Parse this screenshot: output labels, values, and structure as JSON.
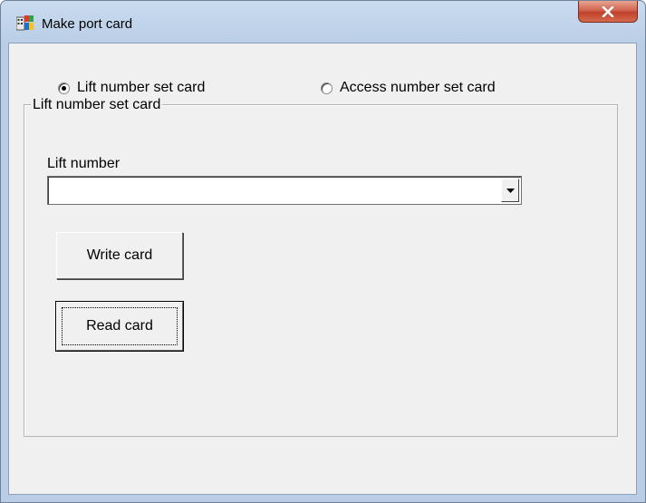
{
  "window": {
    "title": "Make port card",
    "icon": "app-icon",
    "close_icon": "close-icon"
  },
  "mode": {
    "options": [
      {
        "label": "Lift number set card",
        "selected": true
      },
      {
        "label": "Access number set card",
        "selected": false
      }
    ]
  },
  "group": {
    "title": "Lift number set card",
    "lift_number_label": "Lift number",
    "lift_number_value": "",
    "dropdown_icon": "chevron-down-icon"
  },
  "buttons": {
    "write": "Write card",
    "read": "Read card"
  },
  "colors": {
    "frame": "#b9cde6",
    "client": "#f0f0f0",
    "close_button": "#c9473a"
  }
}
